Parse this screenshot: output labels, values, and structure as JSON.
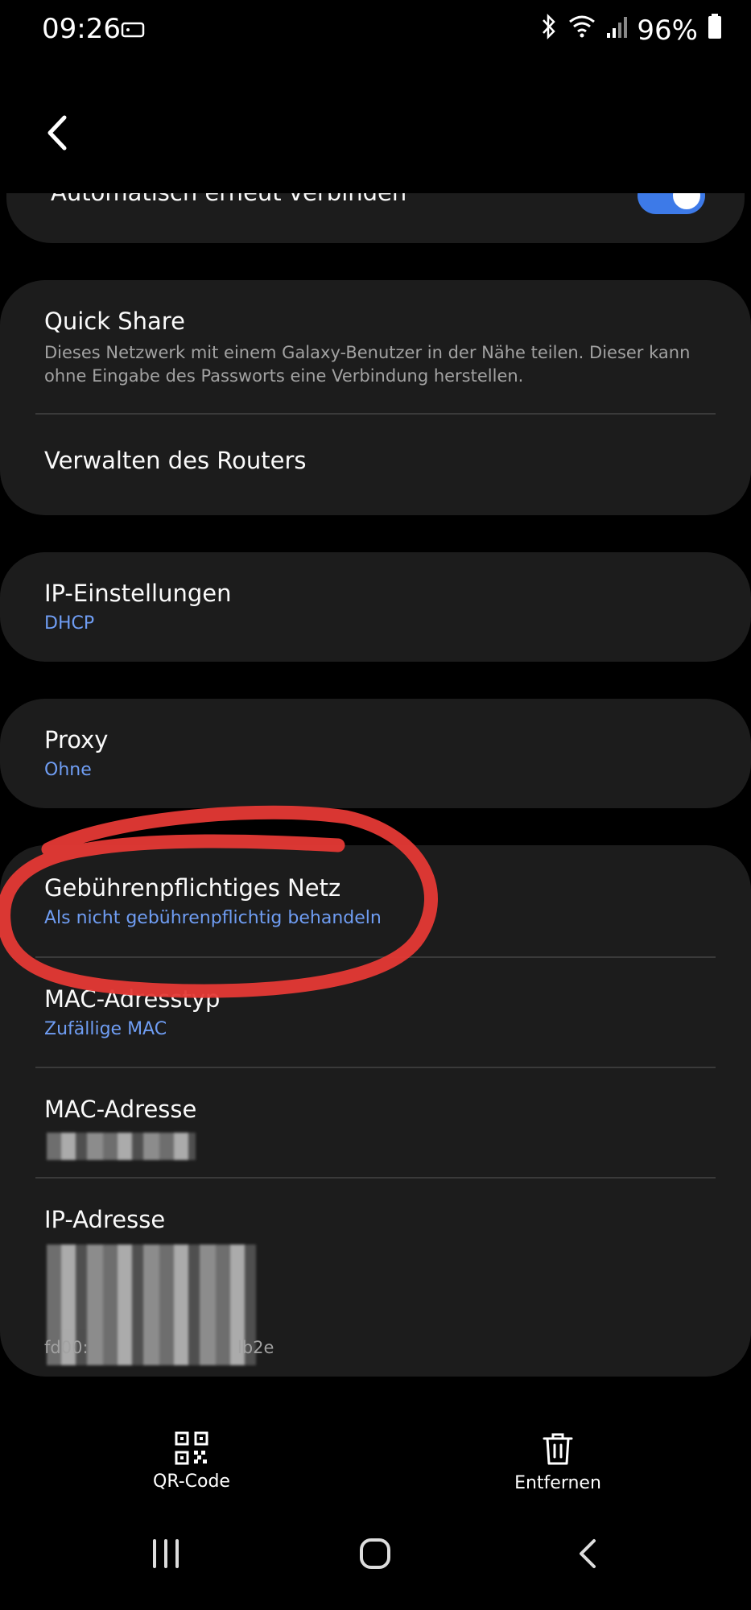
{
  "status_bar": {
    "time": "09:26",
    "battery": "96%"
  },
  "cards": {
    "auto_reconnect": {
      "title": "Automatisch erneut verbinden",
      "toggle_on": true
    },
    "quick_share": {
      "title": "Quick Share",
      "description": "Dieses Netzwerk mit einem Galaxy-Benutzer in der Nähe teilen. Dieser kann ohne Eingabe des Passworts eine Verbindung herstellen."
    },
    "router": {
      "title": "Verwalten des Routers"
    },
    "ip_settings": {
      "title": "IP-Einstellungen",
      "value": "DHCP"
    },
    "proxy": {
      "title": "Proxy",
      "value": "Ohne"
    },
    "metered": {
      "title": "Gebührenpflichtiges Netz",
      "value": "Als nicht gebührenpflichtig behandeln"
    },
    "mac_type": {
      "title": "MAC-Adresstyp",
      "value": "Zufällige MAC"
    },
    "mac_address": {
      "title": "MAC-Adresse"
    },
    "ip_address": {
      "title": "IP-Adresse",
      "value_partial_start": "fd00:",
      "value_partial_end": "lb2e"
    }
  },
  "bottom_actions": {
    "qr": "QR-Code",
    "remove": "Entfernen"
  },
  "colors": {
    "accent": "#6f9df3",
    "toggle": "#3d7ae8",
    "card": "#1c1c1c",
    "annotation": "#e53935"
  }
}
